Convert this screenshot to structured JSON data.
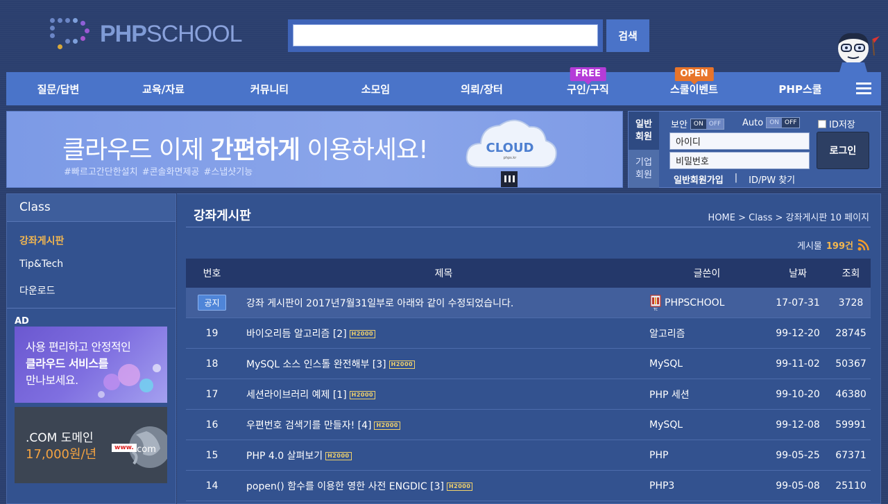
{
  "header": {
    "logo_php": "PHP",
    "logo_school": "SCHOOL",
    "search_placeholder": "",
    "search_button": "검색"
  },
  "nav": {
    "items": [
      {
        "label": "질문/답변",
        "badge": ""
      },
      {
        "label": "교육/자료",
        "badge": ""
      },
      {
        "label": "커뮤니티",
        "badge": ""
      },
      {
        "label": "소모임",
        "badge": ""
      },
      {
        "label": "의뢰/장터",
        "badge": ""
      },
      {
        "label": "구인/구직",
        "badge": "FREE"
      },
      {
        "label": "스쿨이벤트",
        "badge": "OPEN"
      },
      {
        "label": "PHP스쿨",
        "badge": ""
      }
    ]
  },
  "banner": {
    "title_pre": "클라우드 이제 ",
    "title_bold": "간편하게",
    "title_post": " 이용하세요!",
    "tags": "#빠르고간단한설치   #콘솔화면제공   #스냅샷기능",
    "cloud_label": "CLOUD",
    "cloud_sub": "phps.kr"
  },
  "login": {
    "tab_member": "일반\n회원",
    "tab_company": "기업\n회원",
    "security_label": "보안",
    "auto_label": "Auto",
    "on": "ON",
    "off": "OFF",
    "id_save": "ID저장",
    "id_placeholder": "아이디",
    "pw_placeholder": "비밀번호",
    "login_button": "로그인",
    "join_link": "일반회원가입",
    "separator": "|",
    "find_link": "ID/PW 찾기"
  },
  "sidebar": {
    "title": "Class",
    "items": [
      {
        "label": "강좌게시판",
        "active": true
      },
      {
        "label": "Tip&Tech",
        "active": false
      },
      {
        "label": "다운로드",
        "active": false
      }
    ],
    "ad_label": "AD",
    "ad1_line1": "사용 편리하고 안정적인",
    "ad1_line2": "클라우드 서비스를",
    "ad1_line3": "만나보세요.",
    "ad2_line1": ".COM 도메인",
    "ad2_line2": "17,000원/년",
    "ad2_www": "www.",
    "ad2_com": ".com"
  },
  "main": {
    "title": "강좌게시판",
    "breadcrumb": "HOME > Class > 강좌게시판 10 페이지",
    "count_label": "게시물",
    "count_value": "199건",
    "columns": {
      "no": "번호",
      "title": "제목",
      "author": "글쓴이",
      "date": "날짜",
      "views": "조회"
    },
    "notice_tag": "공지",
    "h2k": "H2000",
    "rows": [
      {
        "no": "공지",
        "title": "강좌 게시판이 2017년7월31일부로 아래와 같이 수정되었습니다.",
        "author": "PHPSCHOOL",
        "date": "17-07-31",
        "views": "3728",
        "notice": true
      },
      {
        "no": "19",
        "title": "바이오리듬 알고리즘 [2]",
        "author": "알고리즘",
        "date": "99-12-20",
        "views": "28745"
      },
      {
        "no": "18",
        "title": "MySQL 소스 인스톨 완전해부 [3]",
        "author": "MySQL",
        "date": "99-11-02",
        "views": "50367"
      },
      {
        "no": "17",
        "title": "세션라이브러리 예제 [1]",
        "author": "PHP 세션",
        "date": "99-10-20",
        "views": "46380"
      },
      {
        "no": "16",
        "title": "우편번호 검색기를 만들자! [4]",
        "author": "MySQL",
        "date": "99-12-08",
        "views": "59991"
      },
      {
        "no": "15",
        "title": "PHP 4.0 살펴보기",
        "author": "PHP",
        "date": "99-05-25",
        "views": "67371"
      },
      {
        "no": "14",
        "title": "popen() 함수를 이용한 영한 사전 ENGDIC [3]",
        "author": "PHP3",
        "date": "99-05-08",
        "views": "25110"
      }
    ]
  },
  "colors": {
    "background": "#2b3f6e",
    "nav": "#4a74c9",
    "accent": "#f3b74f",
    "free_badge": "#b53cd8",
    "open_badge": "#e8742a"
  }
}
